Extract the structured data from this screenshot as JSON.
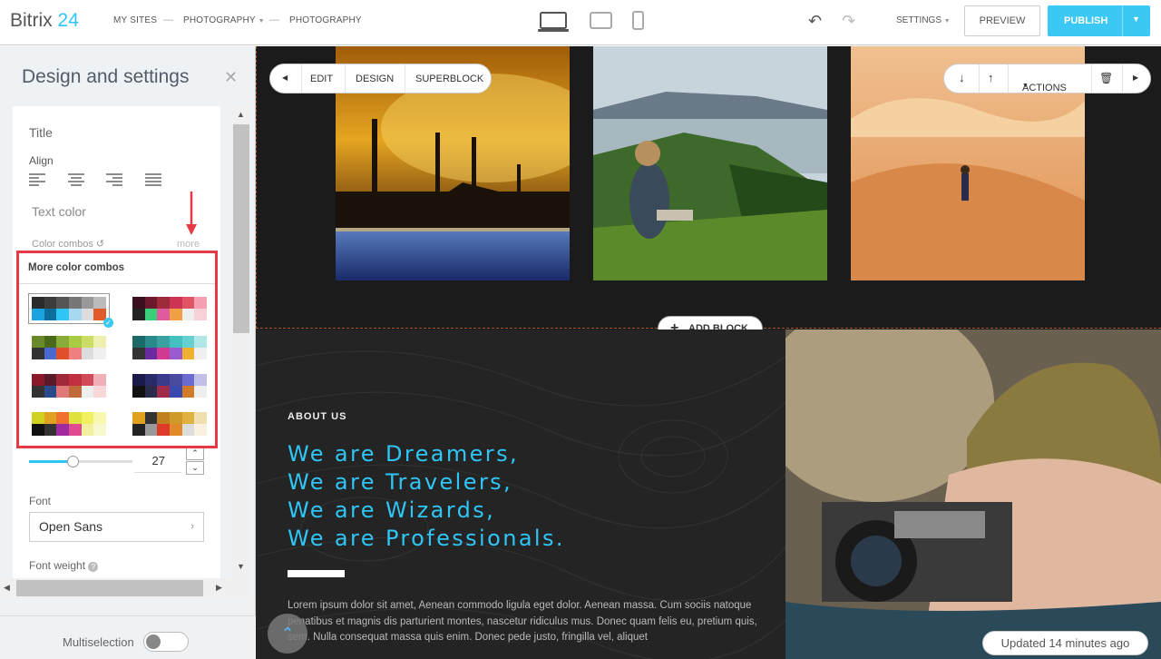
{
  "header": {
    "logo_text": "Bitrix",
    "logo_number": "24",
    "breadcrumb": [
      "MY SITES",
      "PHOTOGRAPHY",
      "PHOTOGRAPHY"
    ],
    "settings_label": "SETTINGS",
    "preview_label": "PREVIEW",
    "publish_label": "PUBLISH",
    "device_icons": [
      "desktop-icon",
      "tablet-icon",
      "mobile-icon"
    ]
  },
  "panel": {
    "title": "Design and settings",
    "section_title": "Title",
    "align_label": "Align",
    "text_color_label": "Text color",
    "color_combos_label": "Color combos",
    "more_label": "more",
    "popup_title": "More color combos",
    "combos": [
      {
        "top": [
          "#2b2b2b",
          "#3c3c3c",
          "#555555",
          "#777777",
          "#999999",
          "#bbbbbb"
        ],
        "bottom": [
          "#1aa3e0",
          "#0d6e9e",
          "#2fc6f6",
          "#a8d8ef",
          "#dddddd",
          "#e05a2a"
        ],
        "selected": true
      },
      {
        "top": [
          "#3a1020",
          "#6b1a2e",
          "#9e2a3a",
          "#cc3355",
          "#e05566",
          "#f4a0b0"
        ],
        "bottom": [
          "#222222",
          "#3ad07a",
          "#e05aa0",
          "#f0a040",
          "#eeeeee",
          "#f8d0d8"
        ],
        "selected": false
      },
      {
        "top": [
          "#6a8a2a",
          "#4a6a1a",
          "#8aaa3a",
          "#aacc44",
          "#ccdd66",
          "#eef0b0"
        ],
        "bottom": [
          "#333333",
          "#4a6ad0",
          "#e0502a",
          "#f08080",
          "#dddddd",
          "#f0f0f0"
        ],
        "selected": false
      },
      {
        "top": [
          "#1a6a6a",
          "#2a8a8a",
          "#3aa0a0",
          "#44c0c0",
          "#66d0d0",
          "#b0e8e8"
        ],
        "bottom": [
          "#333333",
          "#6a2aa0",
          "#d03a90",
          "#9a5ad0",
          "#f0b030",
          "#f0f0f0"
        ],
        "selected": false
      },
      {
        "top": [
          "#8a1a2a",
          "#5a1a2a",
          "#a02a3a",
          "#c03040",
          "#d04a5a",
          "#f0b0b8"
        ],
        "bottom": [
          "#333333",
          "#2a4a8a",
          "#e07a7a",
          "#c06a3a",
          "#eeeeee",
          "#f8d8d8"
        ],
        "selected": false
      },
      {
        "top": [
          "#1a1a4a",
          "#2a2a6a",
          "#3a3a8a",
          "#4a4aa0",
          "#6a6ad0",
          "#c0c0e8"
        ],
        "bottom": [
          "#111111",
          "#2a2a4a",
          "#a02a4a",
          "#3a4ab0",
          "#d07a2a",
          "#eeeeee"
        ],
        "selected": false
      },
      {
        "top": [
          "#d0d020",
          "#e0a020",
          "#f07030",
          "#e0e040",
          "#f0f060",
          "#f8f8b0"
        ],
        "bottom": [
          "#111111",
          "#333333",
          "#a02aa0",
          "#e04a90",
          "#f0f0a0",
          "#f8f8d0"
        ],
        "selected": false
      },
      {
        "top": [
          "#e0a020",
          "#333333",
          "#c08020",
          "#d09a2a",
          "#e0b040",
          "#f0e0b0"
        ],
        "bottom": [
          "#222222",
          "#999999",
          "#e03a2a",
          "#e08a2a",
          "#dddddd",
          "#f8f0e0"
        ],
        "selected": false
      }
    ],
    "size_value": "27",
    "size_slider_fraction": 0.42,
    "font_label": "Font",
    "font_value": "Open Sans",
    "font_weight_label": "Font weight",
    "multiselection_label": "Multiselection"
  },
  "canvas": {
    "toolbar_left": [
      "EDIT",
      "DESIGN",
      "SUPERBLOCK"
    ],
    "toolbar_right_actions": "ACTIONS",
    "add_block_label": "ADD BLOCK",
    "about_kicker": "ABOUT US",
    "tagline": [
      "We are Dreamers,",
      "We are Travelers,",
      "We are Wizards,",
      "We are Professionals."
    ],
    "lorem": "Lorem ipsum dolor sit amet, Aenean commodo ligula eget dolor. Aenean massa. Cum sociis natoque penatibus et magnis dis parturient montes, nascetur ridiculus mus. Donec quam felis eu, pretium quis, sem. Nulla consequat massa quis enim. Donec pede justo, fringilla vel, aliquet",
    "updated_label": "Updated 14 minutes ago"
  }
}
